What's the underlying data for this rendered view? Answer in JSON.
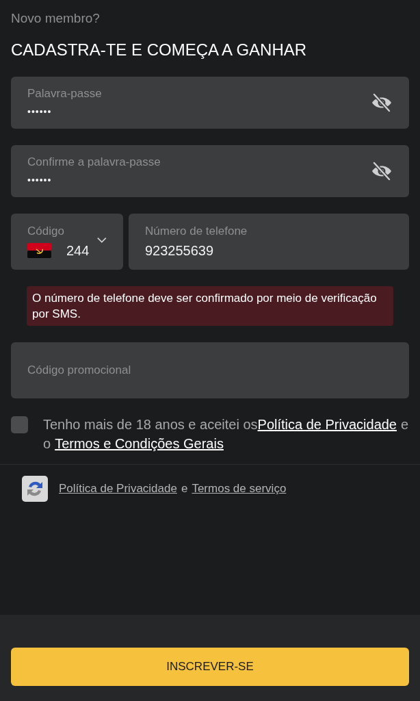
{
  "header": {
    "subtitle": "Novo membro?",
    "title": "CADASTRA-TE E COMEÇA A GANHAR"
  },
  "password_fields": [
    {
      "label": "Palavra-passe",
      "value": "••••••",
      "masked": true
    },
    {
      "label": "Confirme a palavra-passe",
      "value": "••••••",
      "masked": true
    }
  ],
  "phone": {
    "code_label": "Código",
    "code": "244",
    "number_label": "Número de telefone",
    "number": "923255639"
  },
  "notice": "O número de telefone deve ser confirmado por meio de verificação por SMS.",
  "promo": {
    "placeholder": "Código promocional"
  },
  "terms": {
    "checked": false,
    "parts": [
      {
        "kind": "text",
        "text": "Tenho mais de 18 anos e aceitei os"
      },
      {
        "kind": "link",
        "text": "Política de Privacidade"
      },
      {
        "kind": "text",
        "text": "e o"
      },
      {
        "kind": "link",
        "text": "Termos e Condições Gerais"
      }
    ]
  },
  "recaptcha": {
    "parts": [
      {
        "kind": "link",
        "text": "Política de Privacidade"
      },
      {
        "kind": "text",
        "text": "e"
      },
      {
        "kind": "link",
        "text": "Termos de serviço"
      }
    ]
  },
  "submit": "INSCREVER-SE"
}
